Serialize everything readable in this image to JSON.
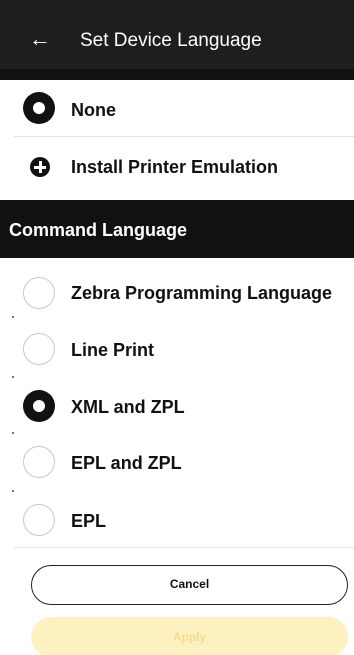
{
  "header": {
    "back_icon": "←",
    "title": "Set Device Language"
  },
  "emulation": {
    "none_label": "None",
    "none_selected": true,
    "install_label": "Install Printer Emulation"
  },
  "command_language": {
    "title": "Command Language",
    "options": [
      {
        "label": "Zebra Programming Language",
        "selected": false
      },
      {
        "label": "Line Print",
        "selected": false
      },
      {
        "label": "XML and ZPL",
        "selected": true
      },
      {
        "label": "EPL and ZPL",
        "selected": false
      },
      {
        "label": "EPL",
        "selected": false
      }
    ]
  },
  "buttons": {
    "cancel": "Cancel",
    "apply": "Apply"
  },
  "colors": {
    "header_bg": "#1e1e1e",
    "section_bg": "#111111",
    "apply_disabled_bg": "#fdf1c2",
    "apply_disabled_text": "#f3dd86"
  }
}
